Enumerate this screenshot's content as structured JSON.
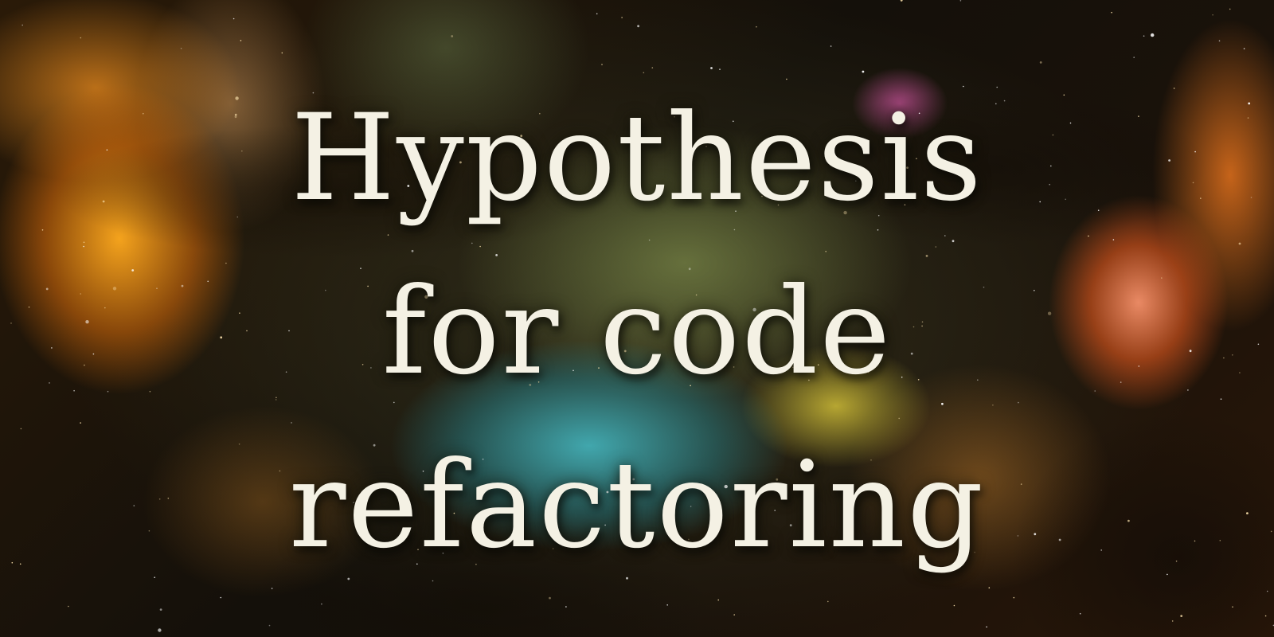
{
  "title": {
    "lines": [
      "Hypothesis",
      "for code",
      "refactoring"
    ],
    "color": "#f4f1e4"
  },
  "background": {
    "description_colors": {
      "deep_space": "#120d07",
      "gold": "#ffaa1e",
      "orange": "#e66e0a",
      "teal": "#46bec8",
      "olive": "#96aa5a",
      "magenta": "#dc5aaa"
    }
  }
}
